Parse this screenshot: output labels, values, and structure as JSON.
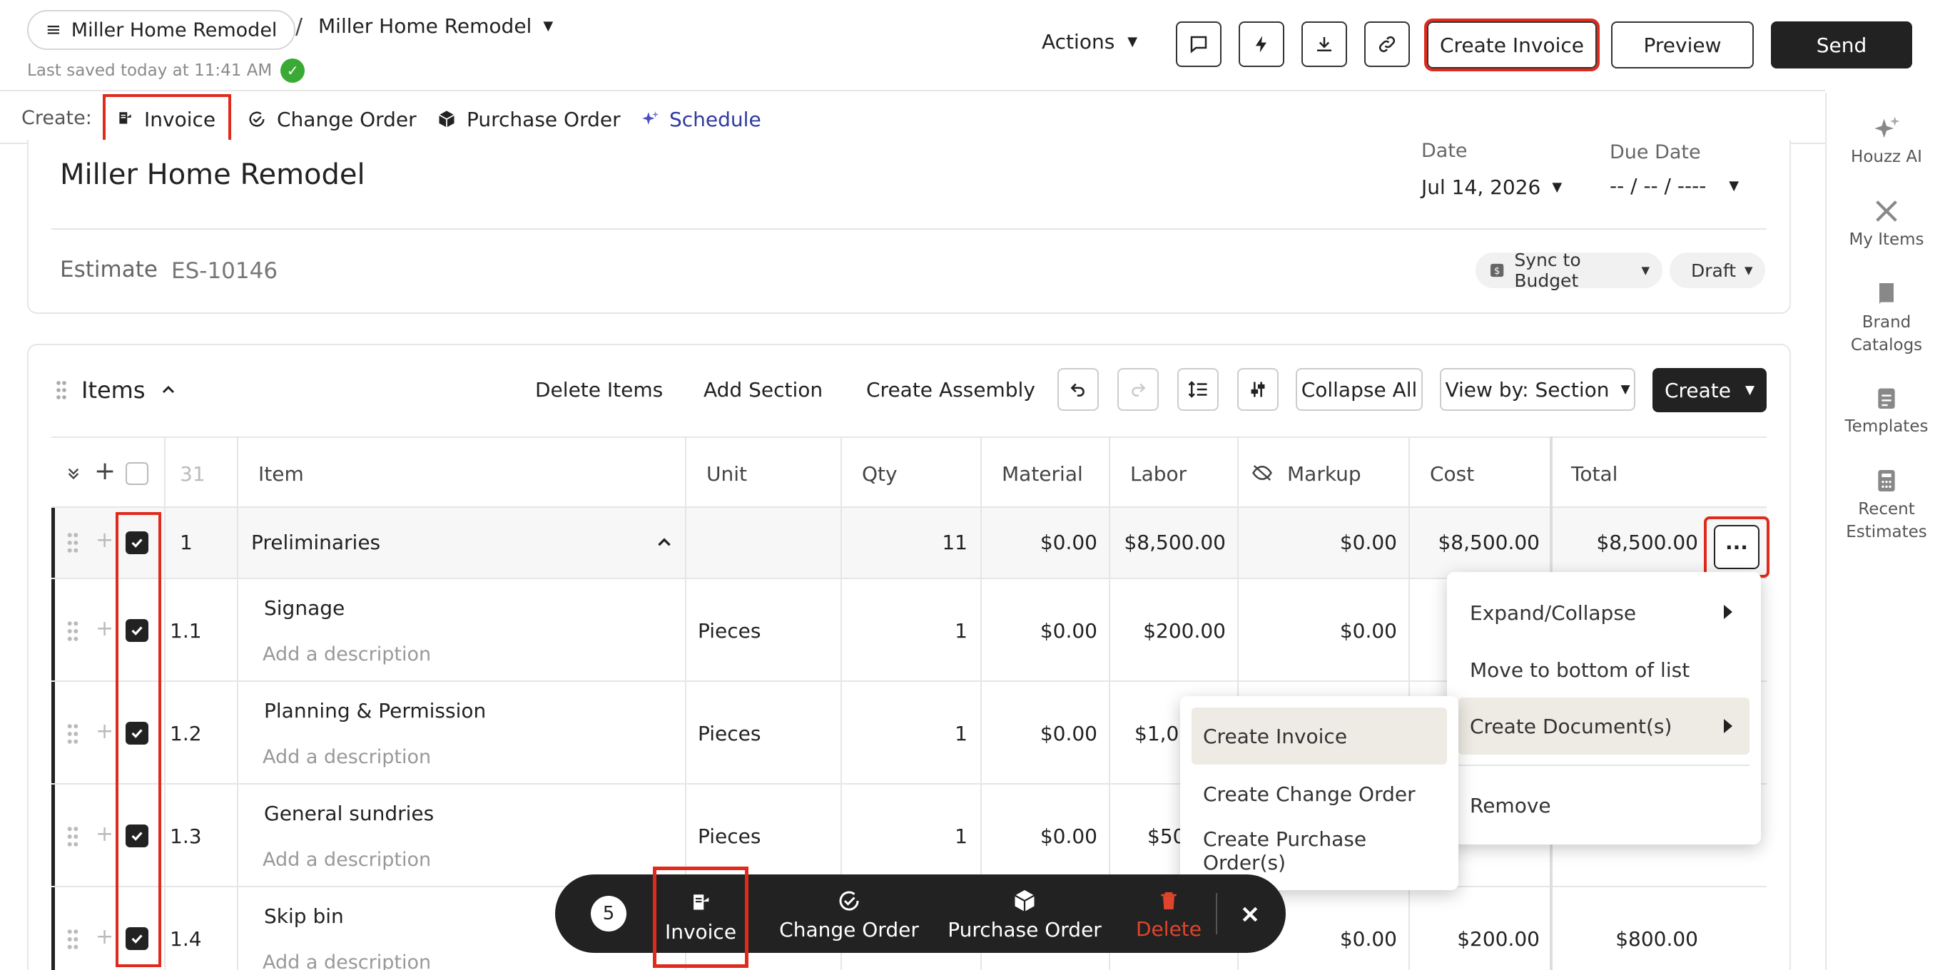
{
  "header": {
    "menu_pill": "Miller Home Remodel",
    "breadcrumb_sep": "/",
    "project_name": "Miller Home Remodel",
    "saved_text": "Last saved today at 11:41 AM",
    "actions_label": "Actions",
    "create_invoice": "Create Invoice",
    "preview": "Preview",
    "send": "Send"
  },
  "create_bar": {
    "label": "Create:",
    "items": [
      {
        "label": "Invoice",
        "icon": "invoice-icon"
      },
      {
        "label": "Change Order",
        "icon": "change-order-icon"
      },
      {
        "label": "Purchase Order",
        "icon": "purchase-order-icon"
      },
      {
        "label": "Schedule",
        "icon": "sparkle-icon"
      }
    ]
  },
  "sidebar": {
    "items": [
      {
        "label": "Houzz AI",
        "icon": "sparkle-icon"
      },
      {
        "label": "My Items",
        "icon": "tools-icon"
      },
      {
        "label": "Brand Catalogs",
        "icon": "book-icon"
      },
      {
        "label": "Templates",
        "icon": "clipboard-icon"
      },
      {
        "label": "Recent Estimates",
        "icon": "calculator-icon"
      }
    ]
  },
  "document": {
    "title": "Miller Home Remodel",
    "date_label": "Date",
    "date_value": "Jul 14, 2026",
    "due_label": "Due Date",
    "due_value": "-- / -- / ----",
    "estimate_label": "Estimate",
    "estimate_number": "ES-10146",
    "sync_label": "Sync to Budget",
    "status": "Draft"
  },
  "items_section": {
    "title": "Items",
    "delete_items": "Delete Items",
    "add_section": "Add Section",
    "create_assembly": "Create Assembly",
    "collapse_all": "Collapse All",
    "view_by": "View by: Section",
    "create": "Create"
  },
  "table": {
    "count": "31",
    "columns": [
      "Item",
      "Unit",
      "Qty",
      "Material",
      "Labor",
      "Markup",
      "Cost",
      "Total"
    ],
    "rows": [
      {
        "num": "1",
        "name": "Preliminaries",
        "unit": "",
        "qty": "11",
        "material": "$0.00",
        "labor": "$8,500.00",
        "markup": "$0.00",
        "cost": "$8,500.00",
        "total": "$8,500.00",
        "section": true
      },
      {
        "num": "1.1",
        "name": "Signage",
        "desc": "Add a description",
        "unit": "Pieces",
        "qty": "1",
        "material": "$0.00",
        "labor": "$200.00",
        "markup": "$0.00"
      },
      {
        "num": "1.2",
        "name": "Planning & Permission",
        "desc": "Add a description",
        "unit": "Pieces",
        "qty": "1",
        "material": "$0.00",
        "labor": "$1,00"
      },
      {
        "num": "1.3",
        "name": "General sundries",
        "desc": "Add a description",
        "unit": "Pieces",
        "qty": "1",
        "material": "$0.00",
        "labor": "$50"
      },
      {
        "num": "1.4",
        "name": "Skip bin",
        "desc": "Add a description",
        "markup": "$0.00",
        "cost": "$200.00",
        "total": "$800.00"
      }
    ]
  },
  "row_menu": {
    "items": [
      "Expand/Collapse",
      "Move to bottom of list",
      "Create Document(s)",
      "Remove"
    ]
  },
  "submenu": {
    "items": [
      "Create Invoice",
      "Create Change Order",
      "Create Purchase Order(s)"
    ]
  },
  "bulk_bar": {
    "count": "5",
    "invoice": "Invoice",
    "change_order": "Change Order",
    "purchase_order": "Purchase Order",
    "delete": "Delete"
  },
  "colors": {
    "highlight": "#e02a1b",
    "dark": "#222222",
    "accent_blue": "#2f3a9e",
    "delete_red": "#e0442c",
    "success": "#3aaa35"
  }
}
